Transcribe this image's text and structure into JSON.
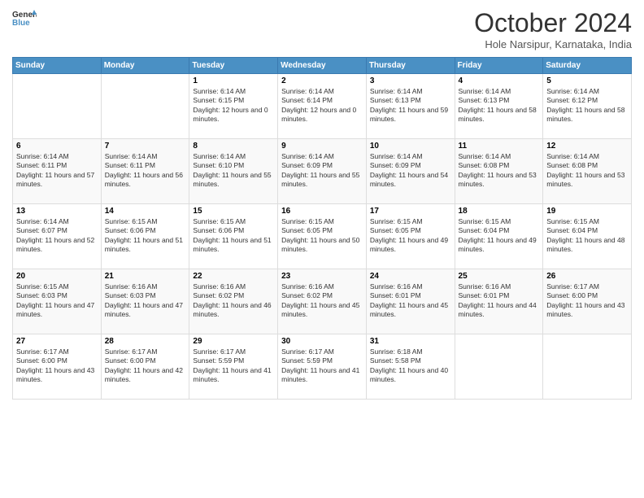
{
  "header": {
    "logo_line1": "General",
    "logo_line2": "Blue",
    "month": "October 2024",
    "location": "Hole Narsipur, Karnataka, India"
  },
  "weekdays": [
    "Sunday",
    "Monday",
    "Tuesday",
    "Wednesday",
    "Thursday",
    "Friday",
    "Saturday"
  ],
  "weeks": [
    [
      {
        "day": "",
        "sunrise": "",
        "sunset": "",
        "daylight": ""
      },
      {
        "day": "",
        "sunrise": "",
        "sunset": "",
        "daylight": ""
      },
      {
        "day": "1",
        "sunrise": "Sunrise: 6:14 AM",
        "sunset": "Sunset: 6:15 PM",
        "daylight": "Daylight: 12 hours and 0 minutes."
      },
      {
        "day": "2",
        "sunrise": "Sunrise: 6:14 AM",
        "sunset": "Sunset: 6:14 PM",
        "daylight": "Daylight: 12 hours and 0 minutes."
      },
      {
        "day": "3",
        "sunrise": "Sunrise: 6:14 AM",
        "sunset": "Sunset: 6:13 PM",
        "daylight": "Daylight: 11 hours and 59 minutes."
      },
      {
        "day": "4",
        "sunrise": "Sunrise: 6:14 AM",
        "sunset": "Sunset: 6:13 PM",
        "daylight": "Daylight: 11 hours and 58 minutes."
      },
      {
        "day": "5",
        "sunrise": "Sunrise: 6:14 AM",
        "sunset": "Sunset: 6:12 PM",
        "daylight": "Daylight: 11 hours and 58 minutes."
      }
    ],
    [
      {
        "day": "6",
        "sunrise": "Sunrise: 6:14 AM",
        "sunset": "Sunset: 6:11 PM",
        "daylight": "Daylight: 11 hours and 57 minutes."
      },
      {
        "day": "7",
        "sunrise": "Sunrise: 6:14 AM",
        "sunset": "Sunset: 6:11 PM",
        "daylight": "Daylight: 11 hours and 56 minutes."
      },
      {
        "day": "8",
        "sunrise": "Sunrise: 6:14 AM",
        "sunset": "Sunset: 6:10 PM",
        "daylight": "Daylight: 11 hours and 55 minutes."
      },
      {
        "day": "9",
        "sunrise": "Sunrise: 6:14 AM",
        "sunset": "Sunset: 6:09 PM",
        "daylight": "Daylight: 11 hours and 55 minutes."
      },
      {
        "day": "10",
        "sunrise": "Sunrise: 6:14 AM",
        "sunset": "Sunset: 6:09 PM",
        "daylight": "Daylight: 11 hours and 54 minutes."
      },
      {
        "day": "11",
        "sunrise": "Sunrise: 6:14 AM",
        "sunset": "Sunset: 6:08 PM",
        "daylight": "Daylight: 11 hours and 53 minutes."
      },
      {
        "day": "12",
        "sunrise": "Sunrise: 6:14 AM",
        "sunset": "Sunset: 6:08 PM",
        "daylight": "Daylight: 11 hours and 53 minutes."
      }
    ],
    [
      {
        "day": "13",
        "sunrise": "Sunrise: 6:14 AM",
        "sunset": "Sunset: 6:07 PM",
        "daylight": "Daylight: 11 hours and 52 minutes."
      },
      {
        "day": "14",
        "sunrise": "Sunrise: 6:15 AM",
        "sunset": "Sunset: 6:06 PM",
        "daylight": "Daylight: 11 hours and 51 minutes."
      },
      {
        "day": "15",
        "sunrise": "Sunrise: 6:15 AM",
        "sunset": "Sunset: 6:06 PM",
        "daylight": "Daylight: 11 hours and 51 minutes."
      },
      {
        "day": "16",
        "sunrise": "Sunrise: 6:15 AM",
        "sunset": "Sunset: 6:05 PM",
        "daylight": "Daylight: 11 hours and 50 minutes."
      },
      {
        "day": "17",
        "sunrise": "Sunrise: 6:15 AM",
        "sunset": "Sunset: 6:05 PM",
        "daylight": "Daylight: 11 hours and 49 minutes."
      },
      {
        "day": "18",
        "sunrise": "Sunrise: 6:15 AM",
        "sunset": "Sunset: 6:04 PM",
        "daylight": "Daylight: 11 hours and 49 minutes."
      },
      {
        "day": "19",
        "sunrise": "Sunrise: 6:15 AM",
        "sunset": "Sunset: 6:04 PM",
        "daylight": "Daylight: 11 hours and 48 minutes."
      }
    ],
    [
      {
        "day": "20",
        "sunrise": "Sunrise: 6:15 AM",
        "sunset": "Sunset: 6:03 PM",
        "daylight": "Daylight: 11 hours and 47 minutes."
      },
      {
        "day": "21",
        "sunrise": "Sunrise: 6:16 AM",
        "sunset": "Sunset: 6:03 PM",
        "daylight": "Daylight: 11 hours and 47 minutes."
      },
      {
        "day": "22",
        "sunrise": "Sunrise: 6:16 AM",
        "sunset": "Sunset: 6:02 PM",
        "daylight": "Daylight: 11 hours and 46 minutes."
      },
      {
        "day": "23",
        "sunrise": "Sunrise: 6:16 AM",
        "sunset": "Sunset: 6:02 PM",
        "daylight": "Daylight: 11 hours and 45 minutes."
      },
      {
        "day": "24",
        "sunrise": "Sunrise: 6:16 AM",
        "sunset": "Sunset: 6:01 PM",
        "daylight": "Daylight: 11 hours and 45 minutes."
      },
      {
        "day": "25",
        "sunrise": "Sunrise: 6:16 AM",
        "sunset": "Sunset: 6:01 PM",
        "daylight": "Daylight: 11 hours and 44 minutes."
      },
      {
        "day": "26",
        "sunrise": "Sunrise: 6:17 AM",
        "sunset": "Sunset: 6:00 PM",
        "daylight": "Daylight: 11 hours and 43 minutes."
      }
    ],
    [
      {
        "day": "27",
        "sunrise": "Sunrise: 6:17 AM",
        "sunset": "Sunset: 6:00 PM",
        "daylight": "Daylight: 11 hours and 43 minutes."
      },
      {
        "day": "28",
        "sunrise": "Sunrise: 6:17 AM",
        "sunset": "Sunset: 6:00 PM",
        "daylight": "Daylight: 11 hours and 42 minutes."
      },
      {
        "day": "29",
        "sunrise": "Sunrise: 6:17 AM",
        "sunset": "Sunset: 5:59 PM",
        "daylight": "Daylight: 11 hours and 41 minutes."
      },
      {
        "day": "30",
        "sunrise": "Sunrise: 6:17 AM",
        "sunset": "Sunset: 5:59 PM",
        "daylight": "Daylight: 11 hours and 41 minutes."
      },
      {
        "day": "31",
        "sunrise": "Sunrise: 6:18 AM",
        "sunset": "Sunset: 5:58 PM",
        "daylight": "Daylight: 11 hours and 40 minutes."
      },
      {
        "day": "",
        "sunrise": "",
        "sunset": "",
        "daylight": ""
      },
      {
        "day": "",
        "sunrise": "",
        "sunset": "",
        "daylight": ""
      }
    ]
  ]
}
